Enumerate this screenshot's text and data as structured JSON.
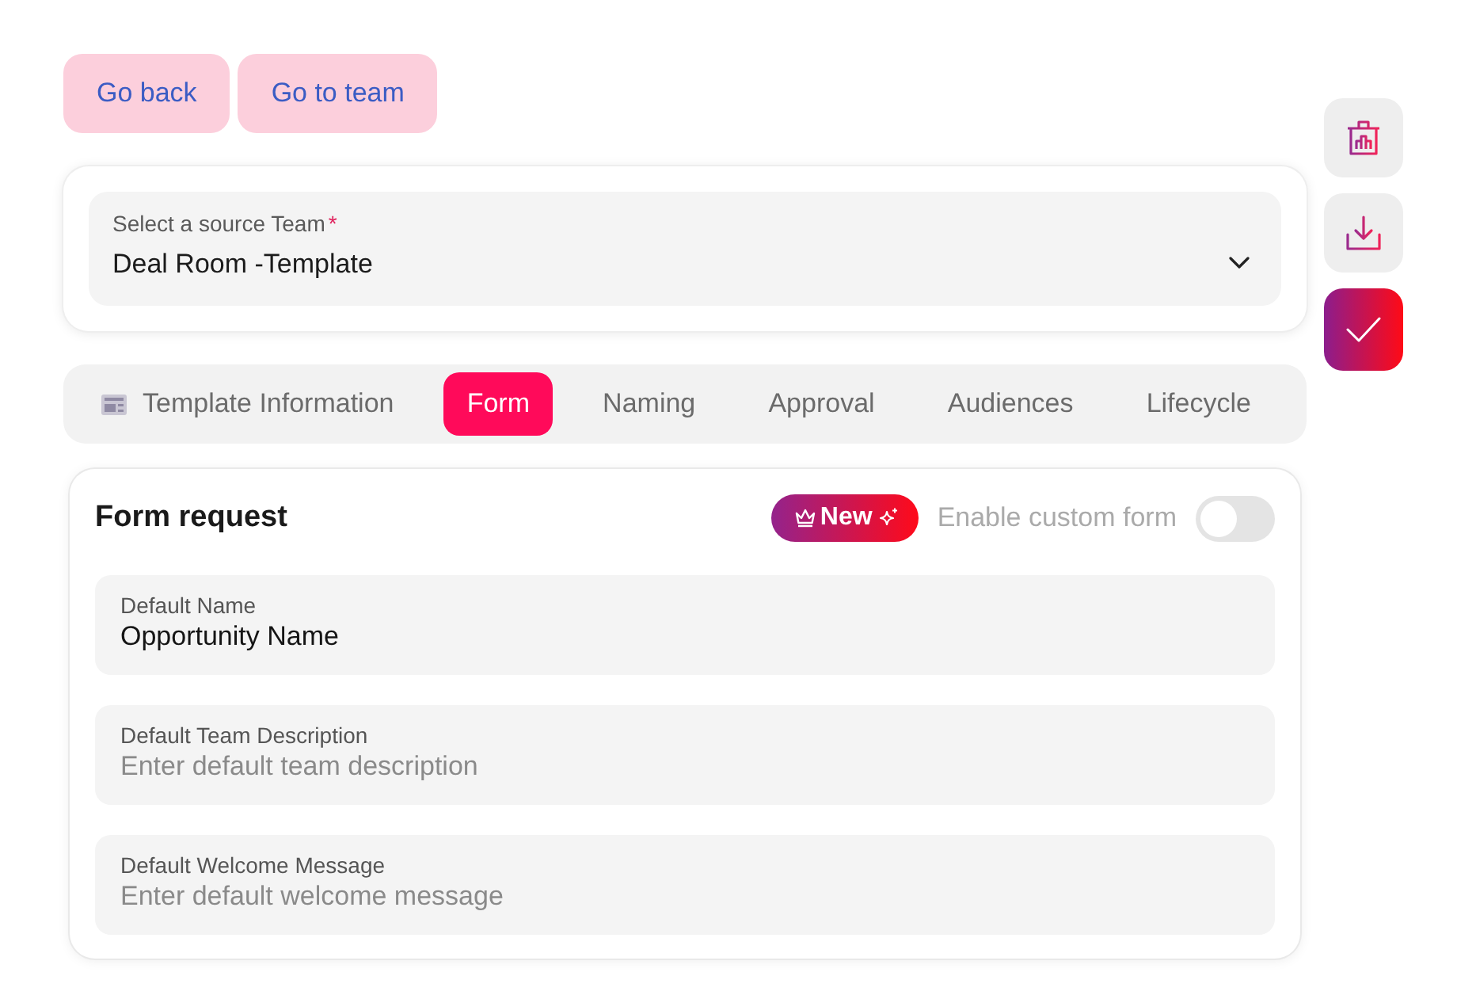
{
  "nav_buttons": [
    {
      "label": "Go back"
    },
    {
      "label": "Go to team"
    }
  ],
  "source_select": {
    "label": "Select a source Team",
    "required_mark": "*",
    "value": "Deal Room -Template"
  },
  "tabs": [
    {
      "label": "Template Information",
      "kind": "icon",
      "selected": false
    },
    {
      "label": "Form",
      "kind": "plain",
      "selected": true
    },
    {
      "label": "Naming",
      "kind": "plain",
      "selected": false
    },
    {
      "label": "Approval",
      "kind": "plain",
      "selected": false
    },
    {
      "label": "Audiences",
      "kind": "plain",
      "selected": false
    },
    {
      "label": "Lifecycle",
      "kind": "plain",
      "selected": false
    }
  ],
  "form": {
    "title": "Form request",
    "badge": "New",
    "toggle": {
      "label": "Enable custom form",
      "on": false
    },
    "fields": [
      {
        "label": "Default Name",
        "value": "Opportunity Name"
      },
      {
        "label": "Default Team Description",
        "placeholder": "Enter default team description"
      },
      {
        "label": "Default Welcome Message",
        "placeholder": "Enter default welcome message"
      }
    ]
  }
}
